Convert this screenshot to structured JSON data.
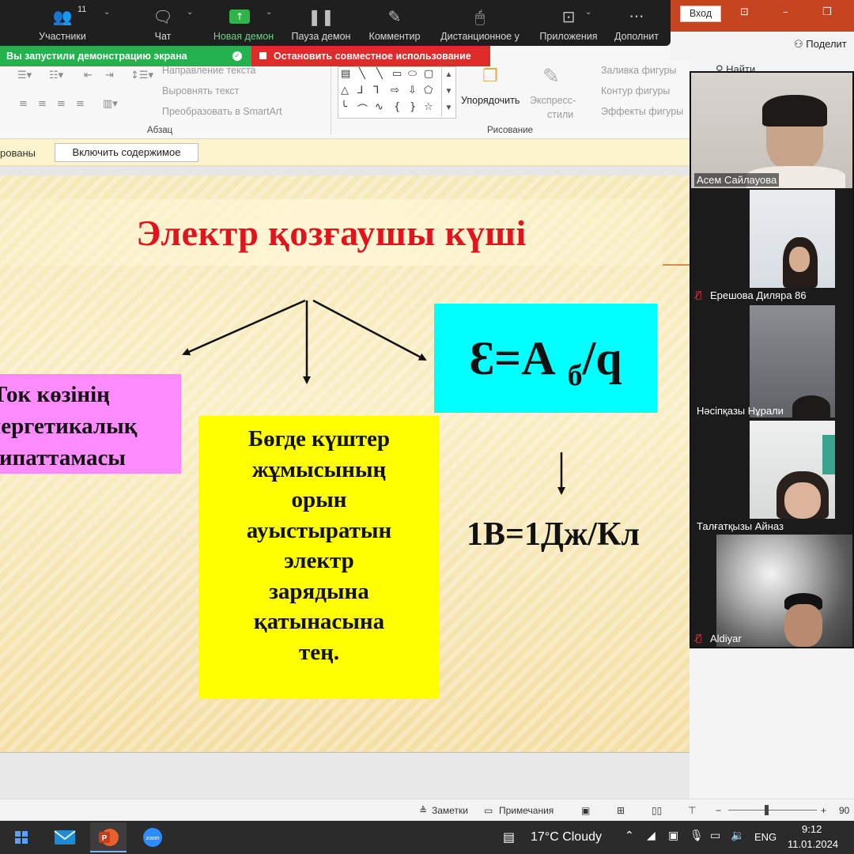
{
  "zoom_toolbar": {
    "participants": {
      "label": "Участники",
      "count": "11"
    },
    "chat": {
      "label": "Чат"
    },
    "new_share": {
      "label": "Новая демон"
    },
    "pause_share": {
      "label": "Пауза демон"
    },
    "annotate": {
      "label": "Комментир"
    },
    "remote_control": {
      "label": "Дистанционное у"
    },
    "apps": {
      "label": "Приложения"
    },
    "more": {
      "label": "Дополнит"
    }
  },
  "share_banner": {
    "text": "Вы запустили демонстрацию экрана",
    "stop_label": "Остановить совместное использование"
  },
  "ppt_window": {
    "sign_in": "Вход",
    "share": "Поделит",
    "find": "Найти"
  },
  "ribbon": {
    "text_direction": "Направление текста",
    "align_text": "Выровнять текст",
    "convert_smartart": "Преобразовать в SmartArt",
    "paragraph_group": "Абзац",
    "arrange": "Упорядочить",
    "quick_styles_1": "Экспресс-",
    "quick_styles_2": "стили",
    "shape_fill": "Заливка фигуры",
    "shape_outline": "Контур фигуры",
    "shape_effects": "Эффекты фигуры",
    "drawing_group": "Рисование"
  },
  "infobar": {
    "text": "рованы",
    "enable_button": "Включить содержимое"
  },
  "slide": {
    "title": "Электр қозғаушы күші",
    "left_box": [
      "Ток көзінің",
      "энергетикалық",
      "сипаттамасы"
    ],
    "center_box": [
      "Бөгде күштер",
      "жұмысының",
      "орын",
      "ауыстыратын",
      "электр",
      "зарядына",
      "қатынасына",
      "тең."
    ],
    "formula": {
      "lhs": "Ɛ=А",
      "sub": "б",
      "rhs": "/q"
    },
    "unit_formula": "1В=1Дж/Кл"
  },
  "participants": [
    {
      "name": "Асем Сайлауова",
      "muted": false
    },
    {
      "name": "Ерешова Диляра 86",
      "muted": true
    },
    {
      "name": "Нәсіпқазы Нұрали",
      "muted": false
    },
    {
      "name": "Талғатқызы Айназ",
      "muted": false
    },
    {
      "name": "Aldiyar",
      "muted": true
    }
  ],
  "status_bar": {
    "notes": "Заметки",
    "comments": "Примечания",
    "zoom_level": "90"
  },
  "taskbar": {
    "weather": "17°C  Cloudy",
    "language": "ENG",
    "time": "9:12",
    "date": "11.01.2024",
    "apps": [
      "mail",
      "powerpoint",
      "zoom"
    ]
  },
  "colors": {
    "zoom_toolbar": "#1f1f1f",
    "share_green": "#23b24d",
    "stop_red": "#e02b2b",
    "ppt_accent": "#c4441f",
    "title_red": "#e0141c",
    "box_pink": "#ff8cff",
    "box_yellow": "#ffff00",
    "box_cyan": "#00ffff"
  }
}
